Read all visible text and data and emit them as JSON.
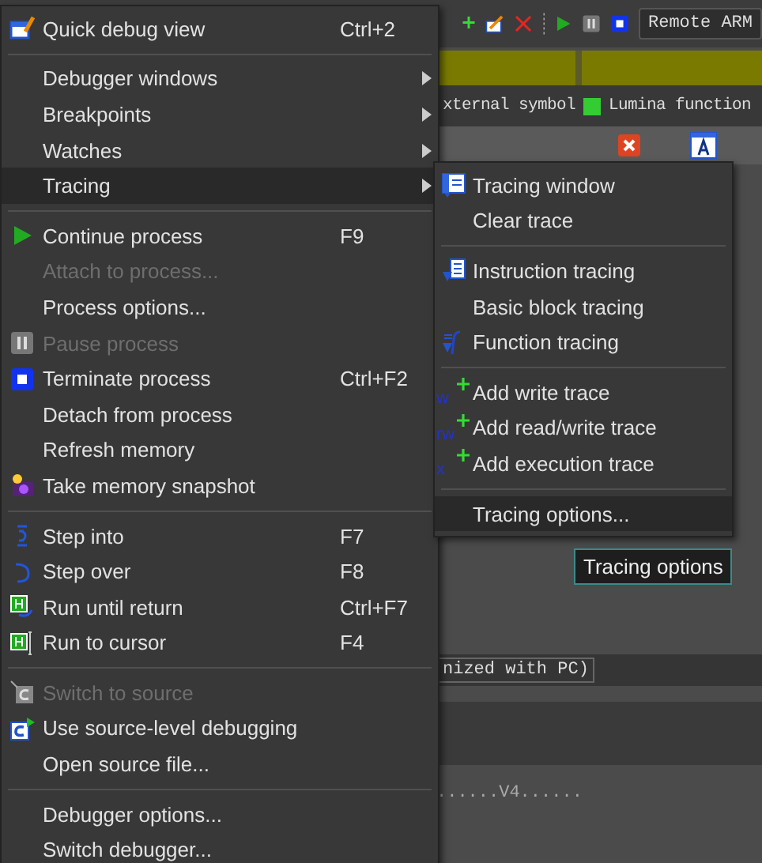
{
  "app": {
    "toolbar": {
      "target": "Remote ARM"
    },
    "legend": [
      {
        "label": "xternal symbol"
      },
      {
        "label": "Lumina function",
        "color": "#33cc33"
      }
    ],
    "status": "nized with PC)",
    "hex_line": "......V4......"
  },
  "menu": {
    "items": [
      {
        "kind": "item",
        "label": "Quick debug view",
        "shortcut": "Ctrl+2",
        "disabled": false,
        "submenu": false,
        "selected": false
      },
      {
        "kind": "separator"
      },
      {
        "kind": "item",
        "label": "Debugger windows",
        "disabled": false,
        "submenu": true,
        "selected": false
      },
      {
        "kind": "item",
        "label": "Breakpoints",
        "disabled": false,
        "submenu": true,
        "selected": false
      },
      {
        "kind": "item",
        "label": "Watches",
        "disabled": false,
        "submenu": true,
        "selected": false
      },
      {
        "kind": "item",
        "label": "Tracing",
        "disabled": false,
        "submenu": true,
        "selected": true
      },
      {
        "kind": "separator"
      },
      {
        "kind": "item",
        "label": "Continue process",
        "shortcut": "F9",
        "disabled": false,
        "submenu": false,
        "selected": false
      },
      {
        "kind": "item",
        "label": "Attach to process...",
        "disabled": true,
        "submenu": false,
        "selected": false
      },
      {
        "kind": "item",
        "label": "Process options...",
        "disabled": false,
        "submenu": false,
        "selected": false
      },
      {
        "kind": "item",
        "label": "Pause process",
        "disabled": true,
        "submenu": false,
        "selected": false
      },
      {
        "kind": "item",
        "label": "Terminate process",
        "shortcut": "Ctrl+F2",
        "disabled": false,
        "submenu": false,
        "selected": false
      },
      {
        "kind": "item",
        "label": "Detach from process",
        "disabled": false,
        "submenu": false,
        "selected": false
      },
      {
        "kind": "item",
        "label": "Refresh memory",
        "disabled": false,
        "submenu": false,
        "selected": false
      },
      {
        "kind": "item",
        "label": "Take memory snapshot",
        "disabled": false,
        "submenu": false,
        "selected": false
      },
      {
        "kind": "separator"
      },
      {
        "kind": "item",
        "label": "Step into",
        "shortcut": "F7",
        "disabled": false,
        "submenu": false,
        "selected": false
      },
      {
        "kind": "item",
        "label": "Step over",
        "shortcut": "F8",
        "disabled": false,
        "submenu": false,
        "selected": false
      },
      {
        "kind": "item",
        "label": "Run until return",
        "shortcut": "Ctrl+F7",
        "disabled": false,
        "submenu": false,
        "selected": false
      },
      {
        "kind": "item",
        "label": "Run to cursor",
        "shortcut": "F4",
        "disabled": false,
        "submenu": false,
        "selected": false
      },
      {
        "kind": "separator"
      },
      {
        "kind": "item",
        "label": "Switch to source",
        "disabled": true,
        "submenu": false,
        "selected": false
      },
      {
        "kind": "item",
        "label": "Use source-level debugging",
        "disabled": false,
        "submenu": false,
        "selected": false
      },
      {
        "kind": "item",
        "label": "Open source file...",
        "disabled": false,
        "submenu": false,
        "selected": false
      },
      {
        "kind": "separator"
      },
      {
        "kind": "item",
        "label": "Debugger options...",
        "disabled": false,
        "submenu": false,
        "selected": false
      },
      {
        "kind": "item",
        "label": "Switch debugger...",
        "disabled": false,
        "submenu": false,
        "selected": false
      }
    ]
  },
  "submenu": {
    "items": [
      {
        "kind": "item",
        "label": "Tracing window",
        "selected": false
      },
      {
        "kind": "item",
        "label": "Clear trace",
        "selected": false
      },
      {
        "kind": "separator"
      },
      {
        "kind": "item",
        "label": "Instruction tracing",
        "selected": false
      },
      {
        "kind": "item",
        "label": "Basic block tracing",
        "selected": false
      },
      {
        "kind": "item",
        "label": "Function tracing",
        "selected": false
      },
      {
        "kind": "separator"
      },
      {
        "kind": "item",
        "label": "Add write trace",
        "icon_text": "w",
        "selected": false
      },
      {
        "kind": "item",
        "label": "Add read/write trace",
        "icon_text": "rw",
        "selected": false
      },
      {
        "kind": "item",
        "label": "Add execution trace",
        "icon_text": "x",
        "selected": false
      },
      {
        "kind": "separator"
      },
      {
        "kind": "item",
        "label": "Tracing options...",
        "selected": true
      }
    ]
  },
  "tooltip": "Tracing options"
}
